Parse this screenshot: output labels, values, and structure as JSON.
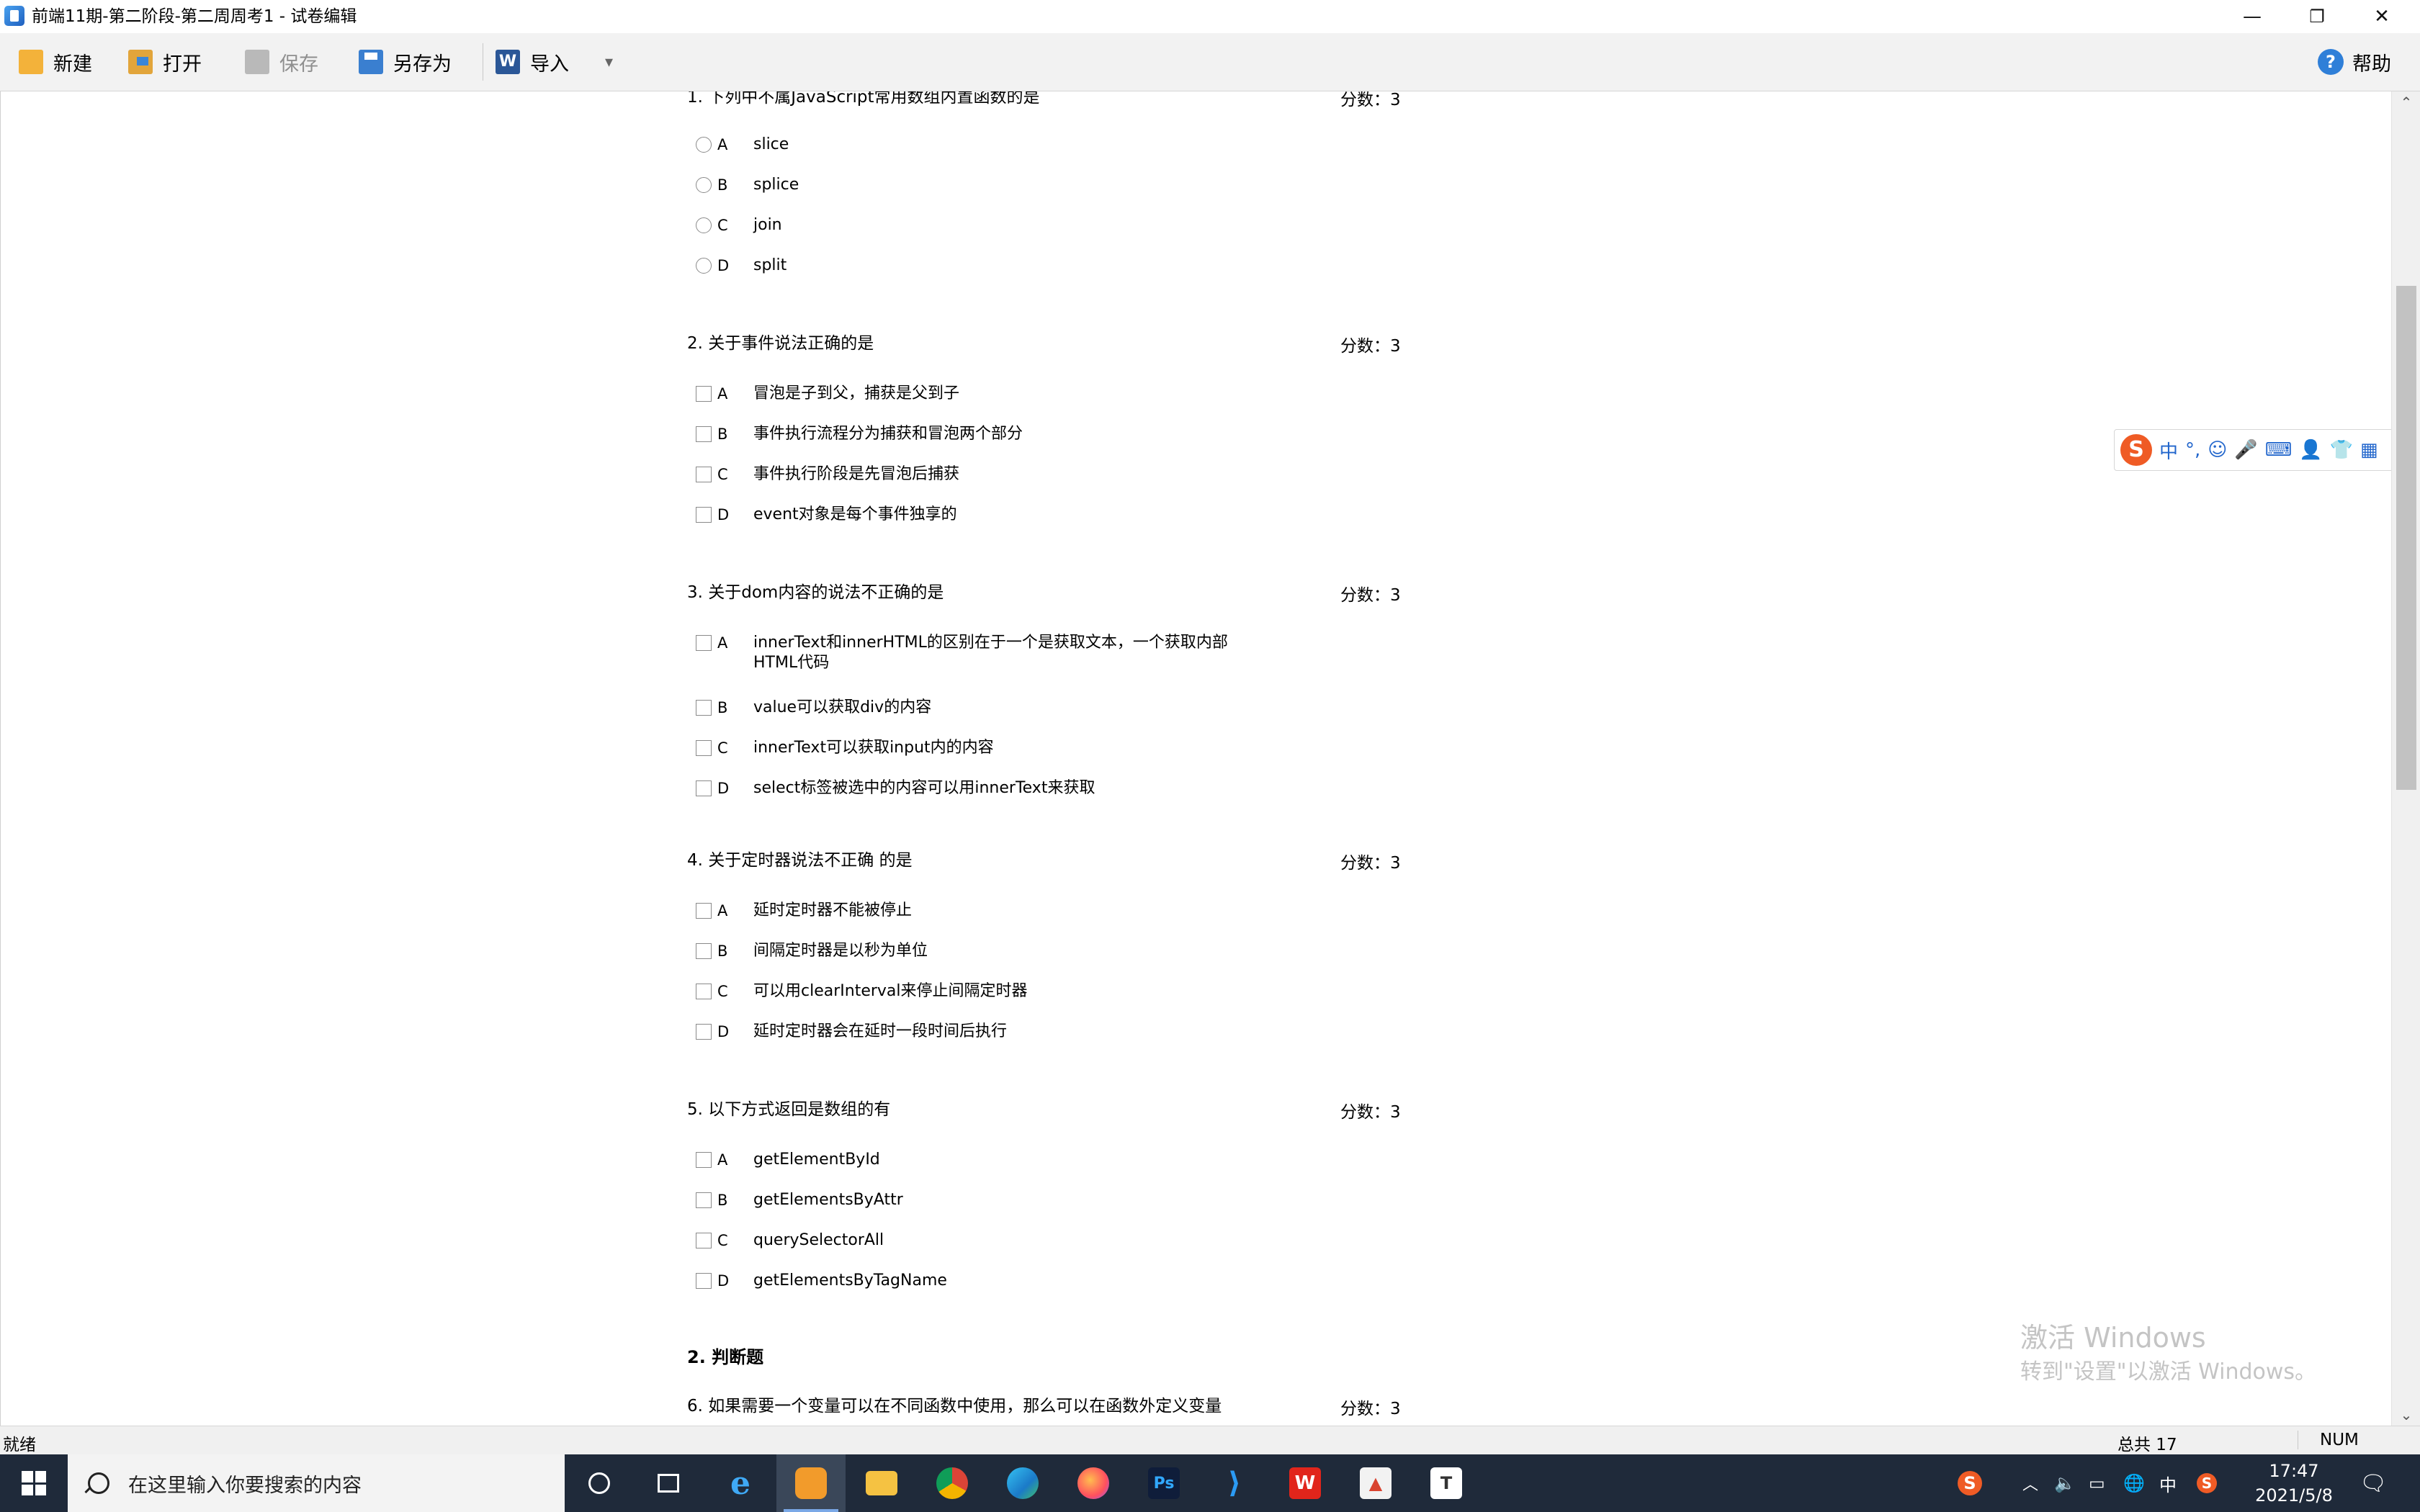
{
  "window": {
    "title": "前端11期-第二阶段-第二周周考1 - 试卷编辑",
    "minimize": "—",
    "restore": "❐",
    "close": "✕"
  },
  "toolbar": {
    "new_label": "新建",
    "open_label": "打开",
    "save_label": "保存",
    "saveas_label": "另存为",
    "import_label": "导入",
    "dropdown": "▾",
    "help_label": "帮助"
  },
  "questions": [
    {
      "title": "1. 下列中不属JavaScript常用数组内置函数的是",
      "score": "分数：3",
      "type": "radio",
      "options": [
        {
          "letter": "A",
          "text": "slice"
        },
        {
          "letter": "B",
          "text": "splice"
        },
        {
          "letter": "C",
          "text": "join"
        },
        {
          "letter": "D",
          "text": "split"
        }
      ]
    },
    {
      "title": "2. 关于事件说法正确的是",
      "score": "分数：3",
      "type": "checkbox",
      "options": [
        {
          "letter": "A",
          "text": "冒泡是子到父，捕获是父到子"
        },
        {
          "letter": "B",
          "text": "事件执行流程分为捕获和冒泡两个部分"
        },
        {
          "letter": "C",
          "text": "事件执行阶段是先冒泡后捕获"
        },
        {
          "letter": "D",
          "text": "event对象是每个事件独享的"
        }
      ]
    },
    {
      "title": "3. 关于dom内容的说法不正确的是",
      "score": "分数：3",
      "type": "checkbox",
      "options": [
        {
          "letter": "A",
          "text": "innerText和innerHTML的区别在于一个是获取文本，一个获取内部HTML代码"
        },
        {
          "letter": "B",
          "text": "value可以获取div的内容"
        },
        {
          "letter": "C",
          "text": "innerText可以获取input内的内容"
        },
        {
          "letter": "D",
          "text": "select标签被选中的内容可以用innerText来获取"
        }
      ]
    },
    {
      "title": "4. 关于定时器说法不正确 的是",
      "score": "分数：3",
      "type": "checkbox",
      "options": [
        {
          "letter": "A",
          "text": "延时定时器不能被停止"
        },
        {
          "letter": "B",
          "text": "间隔定时器是以秒为单位"
        },
        {
          "letter": "C",
          "text": "可以用clearInterval来停止间隔定时器"
        },
        {
          "letter": "D",
          "text": "延时定时器会在延时一段时间后执行"
        }
      ]
    },
    {
      "title": "5. 以下方式返回是数组的有",
      "score": "分数：3",
      "type": "checkbox",
      "options": [
        {
          "letter": "A",
          "text": "getElementById"
        },
        {
          "letter": "B",
          "text": "getElementsByAttr"
        },
        {
          "letter": "C",
          "text": "querySelectorAll"
        },
        {
          "letter": "D",
          "text": "getElementsByTagName"
        }
      ]
    }
  ],
  "section2": {
    "title": "2. 判断题",
    "q6_title": "6. 如果需要一个变量可以在不同函数中使用，那么可以在函数外定义变量",
    "q6_score": "分数：3"
  },
  "ime": {
    "logo": "S",
    "mode": "中",
    "punct": "°,",
    "emoji": "☺",
    "mic": "🎤",
    "keyboard": "⌨",
    "user": "👤",
    "skin": "👕",
    "menu": "▦"
  },
  "watermark": {
    "line1": "激活 Windows",
    "line2": "转到\"设置\"以激活 Windows。"
  },
  "statusbar": {
    "left": "就绪",
    "total": "总共 17",
    "num": "NUM"
  },
  "taskbar": {
    "search_placeholder": "在这里输入你要搜索的内容",
    "tray_ime": "中",
    "time": "17:47",
    "date": "2021/5/8"
  },
  "colors": {
    "taskbar_bg": "#1f2a3a",
    "toolbar_bg": "#f2f2f2",
    "sogou_orange": "#ef5b25"
  }
}
